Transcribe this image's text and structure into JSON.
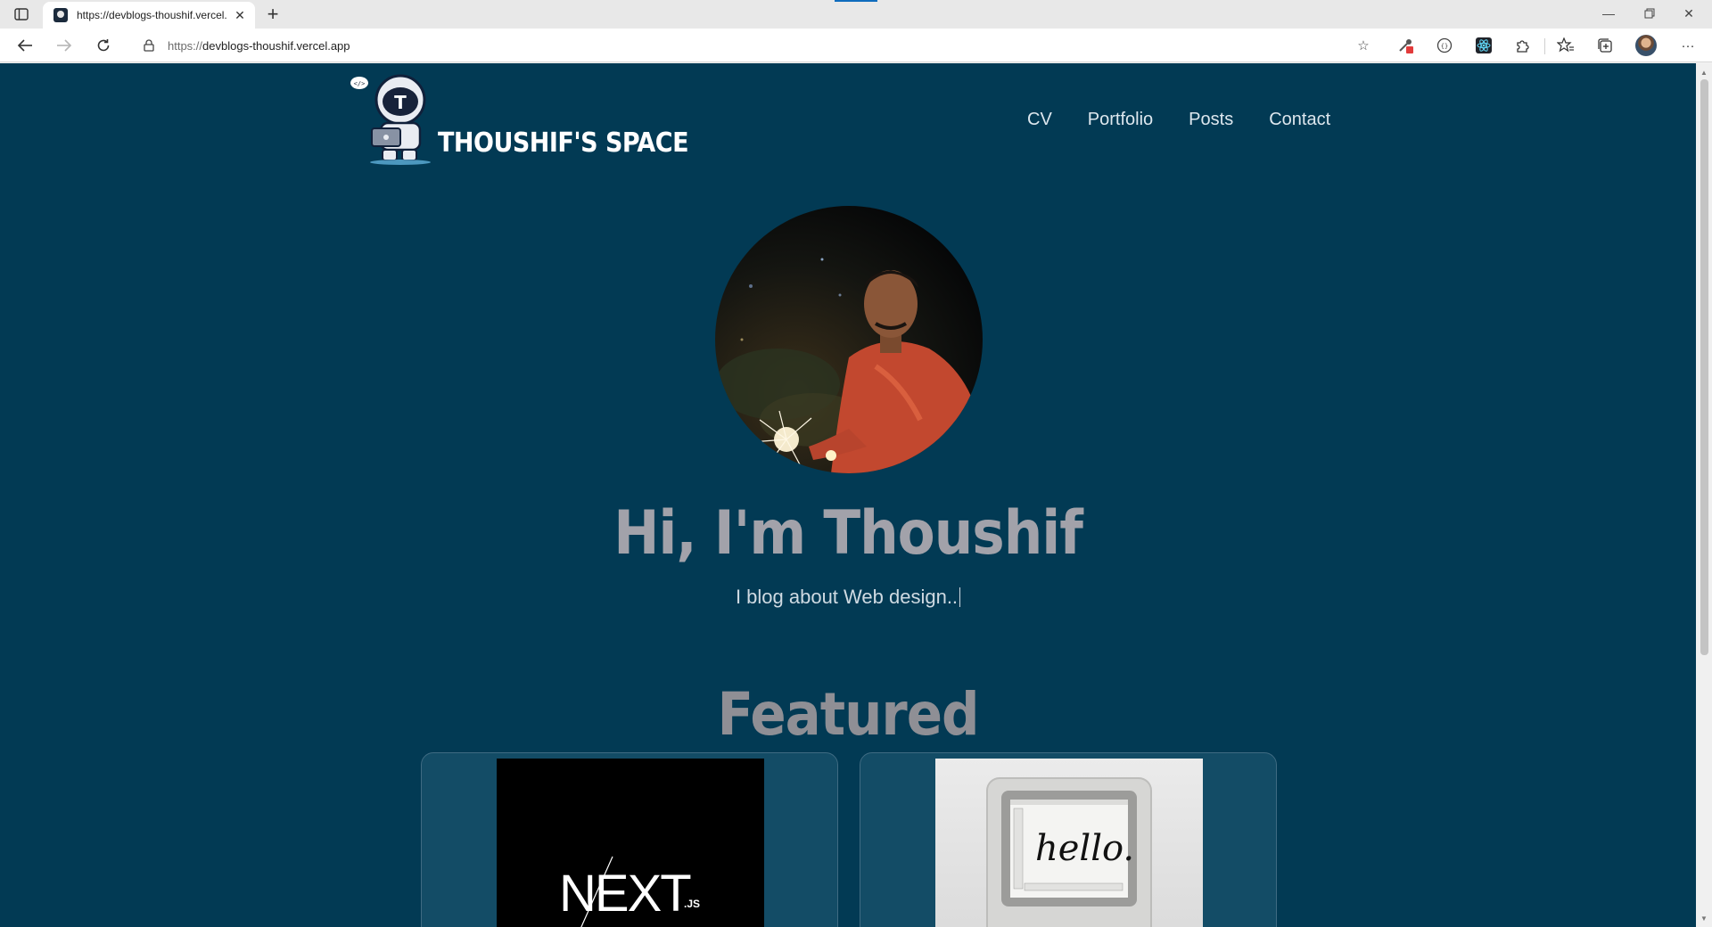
{
  "browser": {
    "tab_title": "https://devblogs-thoushif.vercel.app",
    "url_scheme": "https://",
    "url_host": "devblogs-thoushif.vercel.app"
  },
  "site": {
    "logo_text": "THOUSHIF'S SPACE",
    "logo_badge": "</>",
    "logo_initial": "T",
    "nav": [
      "CV",
      "Portfolio",
      "Posts",
      "Contact"
    ]
  },
  "hero": {
    "title": "Hi, I'm Thoushif",
    "subtitle": "I blog about Web design.."
  },
  "featured": {
    "heading": "Featured",
    "cards": [
      {
        "thumb_text": "NEXT",
        "thumb_suffix": ".JS"
      },
      {
        "thumb_text": "hello."
      }
    ]
  },
  "colors": {
    "page_background": "#023a54",
    "card_background": "#134c66",
    "title_text": "#a2a2aa",
    "nav_text": "#dde7ee"
  }
}
